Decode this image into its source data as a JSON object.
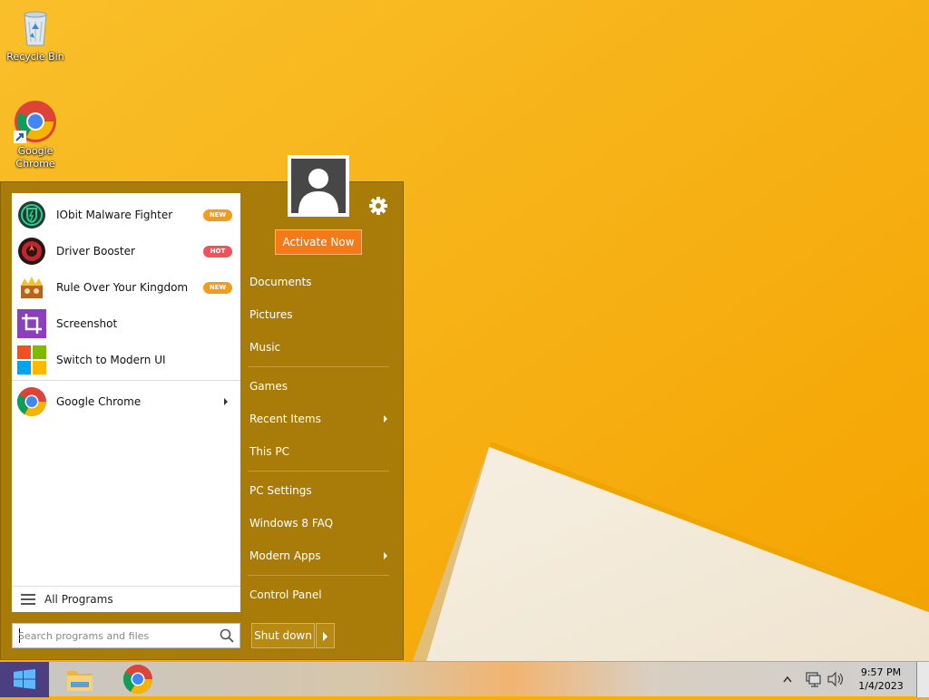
{
  "desktop": {
    "icons": [
      {
        "label": "Recycle Bin"
      },
      {
        "label": "Google Chrome"
      }
    ]
  },
  "start_menu": {
    "programs": [
      {
        "label": "IObit Malware Fighter",
        "badge": "NEW",
        "icon": "iobit-malware-fighter-icon"
      },
      {
        "label": "Driver Booster",
        "badge": "HOT",
        "icon": "driver-booster-icon"
      },
      {
        "label": "Rule Over Your Kingdom",
        "badge": "NEW",
        "icon": "kingdom-game-icon"
      },
      {
        "label": "Screenshot",
        "icon": "crop-screenshot-icon"
      },
      {
        "label": "Switch to Modern UI",
        "icon": "windows-tiles-icon"
      },
      {
        "label": "Google Chrome",
        "icon": "chrome-icon"
      }
    ],
    "all_programs_label": "All Programs",
    "search_placeholder": "Search programs and files",
    "activate_label": "Activate Now",
    "right_items": [
      {
        "label": "Documents"
      },
      {
        "label": "Pictures"
      },
      {
        "label": "Music"
      },
      {
        "label": "Games"
      },
      {
        "label": "Recent Items"
      },
      {
        "label": "This PC"
      },
      {
        "label": "PC Settings"
      },
      {
        "label": "Windows 8 FAQ"
      },
      {
        "label": "Modern Apps"
      },
      {
        "label": "Control Panel"
      }
    ],
    "shutdown_label": "Shut down"
  },
  "taskbar": {
    "time": "9:57 PM",
    "date": "1/4/2023"
  },
  "colors": {
    "wallpaper": "#f6ae08",
    "menu_bg": "#a97c0a",
    "activate": "#f37a16",
    "badge_new": "#f39b1b",
    "badge_hot": "#f2525c"
  }
}
